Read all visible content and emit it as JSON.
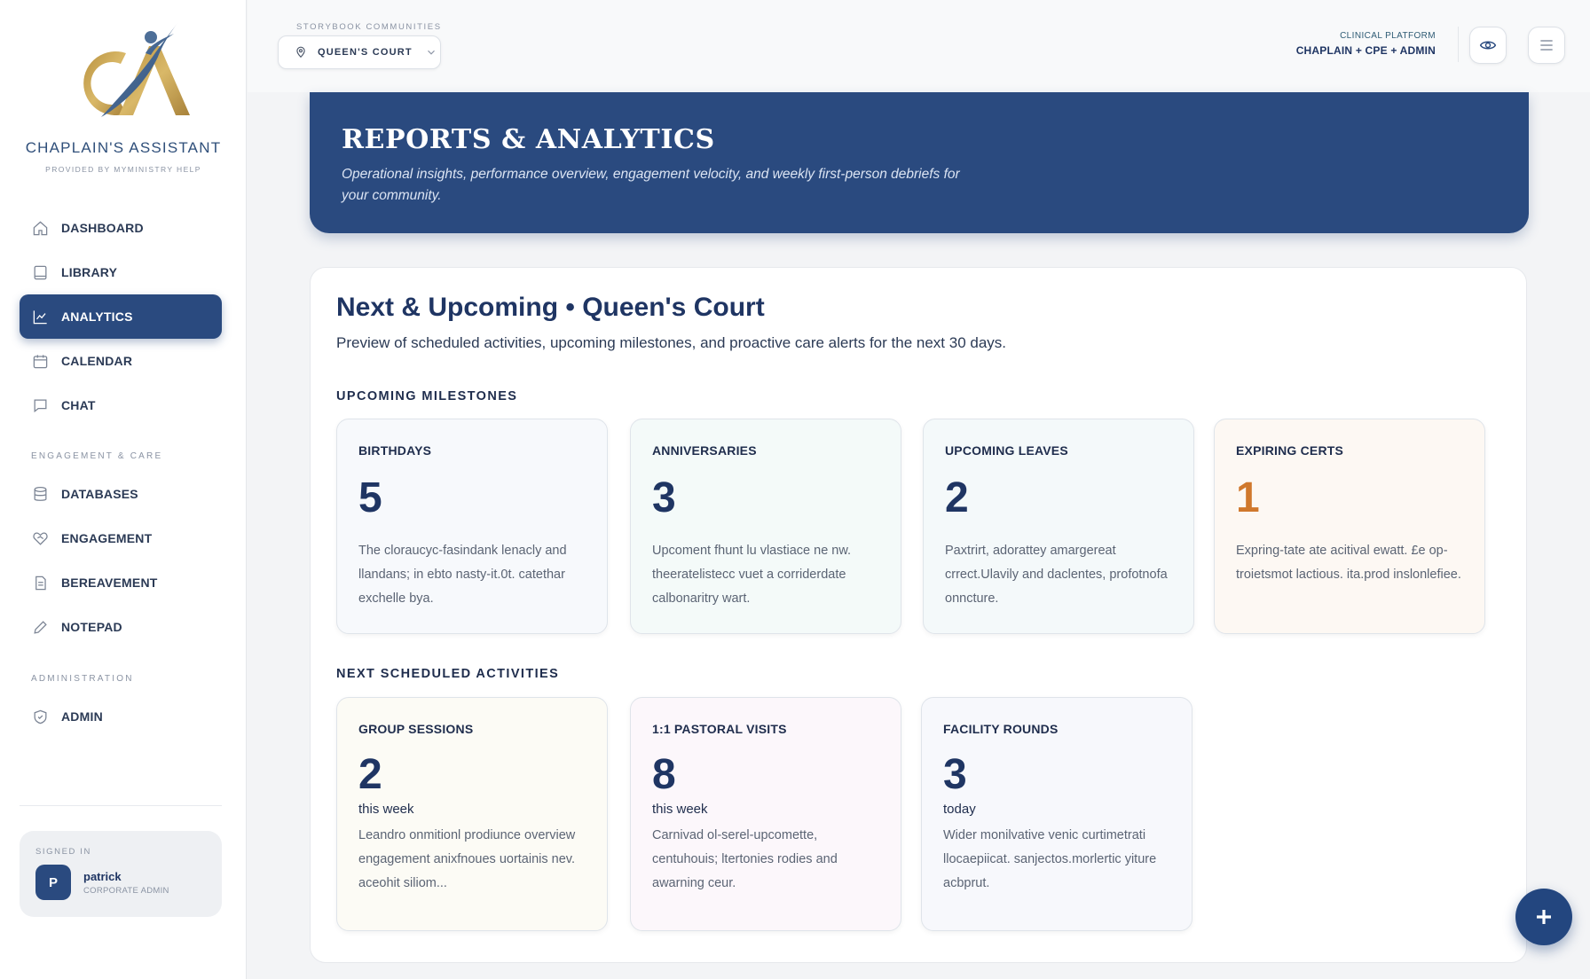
{
  "brand": {
    "name": "CHAPLAIN'S ASSISTANT",
    "subtitle": "PROVIDED BY MYMINISTRY HELP"
  },
  "sidebar": {
    "main_items": [
      {
        "label": "DASHBOARD",
        "icon": "home-icon",
        "active": false
      },
      {
        "label": "LIBRARY",
        "icon": "book-icon",
        "active": false
      },
      {
        "label": "ANALYTICS",
        "icon": "chart-icon",
        "active": true
      },
      {
        "label": "CALENDAR",
        "icon": "calendar-icon",
        "active": false
      },
      {
        "label": "CHAT",
        "icon": "chat-icon",
        "active": false
      }
    ],
    "engagement_section": "ENGAGEMENT & CARE",
    "engagement_items": [
      {
        "label": "DATABASES",
        "icon": "database-icon"
      },
      {
        "label": "ENGAGEMENT",
        "icon": "heart-handshake-icon"
      },
      {
        "label": "BEREAVEMENT",
        "icon": "document-icon"
      },
      {
        "label": "NOTEPAD",
        "icon": "pencil-icon"
      }
    ],
    "admin_section": "ADMINISTRATION",
    "admin_items": [
      {
        "label": "ADMIN",
        "icon": "shield-icon"
      }
    ]
  },
  "user": {
    "signed_in_label": "SIGNED IN",
    "initial": "P",
    "name": "patrick",
    "role": "CORPORATE ADMIN"
  },
  "topbar": {
    "community_label": "STORYBOOK COMMUNITIES",
    "community_value": "QUEEN'S COURT",
    "platform_label": "CLINICAL PLATFORM",
    "platform_roles": "CHAPLAIN + CPE + ADMIN"
  },
  "hero": {
    "title": "REPORTS & ANALYTICS",
    "subtitle": "Operational insights, performance overview, engagement velocity, and weekly first-person debriefs for your community."
  },
  "card": {
    "title": "Next & Upcoming • Queen's Court",
    "description": "Preview of scheduled activities, upcoming milestones, and proactive care alerts for the next 30 days.",
    "milestones_heading": "UPCOMING MILESTONES",
    "milestones": [
      {
        "label": "BIRTHDAYS",
        "value": "5",
        "body": "The cloraucyc-fasindank lenacly and llandans; in ebto nasty-it.0t. catethar exchelle bya.",
        "bg": "#f7f9fc",
        "value_color": "#1f3563"
      },
      {
        "label": "ANNIVERSARIES",
        "value": "3",
        "body": "Upcoment fhunt lu vlastiace ne nw. theeratelistecc vuet a corriderdate calbonaritry wart.",
        "bg": "#f4faf9",
        "value_color": "#1f3563"
      },
      {
        "label": "UPCOMING LEAVES",
        "value": "2",
        "body": "Paxtrirt, adorattey amargereat crrect.Ulavily and daclentes, profotnofa onncture.",
        "bg": "#f4f9fa",
        "value_color": "#1f3563"
      },
      {
        "label": "EXPIRING CERTS",
        "value": "1",
        "body": "Expring-tate ate acitival ewatt. £e op-troietsmot lactious. ita.prod inslonlefiee.",
        "bg": "#fdf8f3",
        "value_color": "#d0782c"
      }
    ],
    "scheduled_heading": "NEXT SCHEDULED ACTIVITIES",
    "scheduled": [
      {
        "label": "GROUP SESSIONS",
        "value": "2",
        "unit": "this week",
        "body": "Leandro onmitionl prodiunce overview engagement anixfnoues uortainis nev. aceohit siliom...",
        "bg": "#fcfbf5"
      },
      {
        "label": "1:1 PASTORAL VISITS",
        "value": "8",
        "unit": "this week",
        "body": "Carnivad ol-serel-upcomette, centuhouis; ltertonies rodies and awarning ceur.",
        "bg": "#fcf7fb"
      },
      {
        "label": "FACILITY ROUNDS",
        "value": "3",
        "unit": "today",
        "body": "Wider monilvative venic curtimetrati llocaepiicat. sanjectos.morlertic yiture acbprut.",
        "bg": "#f7f8fc"
      }
    ]
  },
  "colors": {
    "primary": "#2a4a7f",
    "accent_orange": "#d0782c",
    "gold": "#c9a14a"
  }
}
